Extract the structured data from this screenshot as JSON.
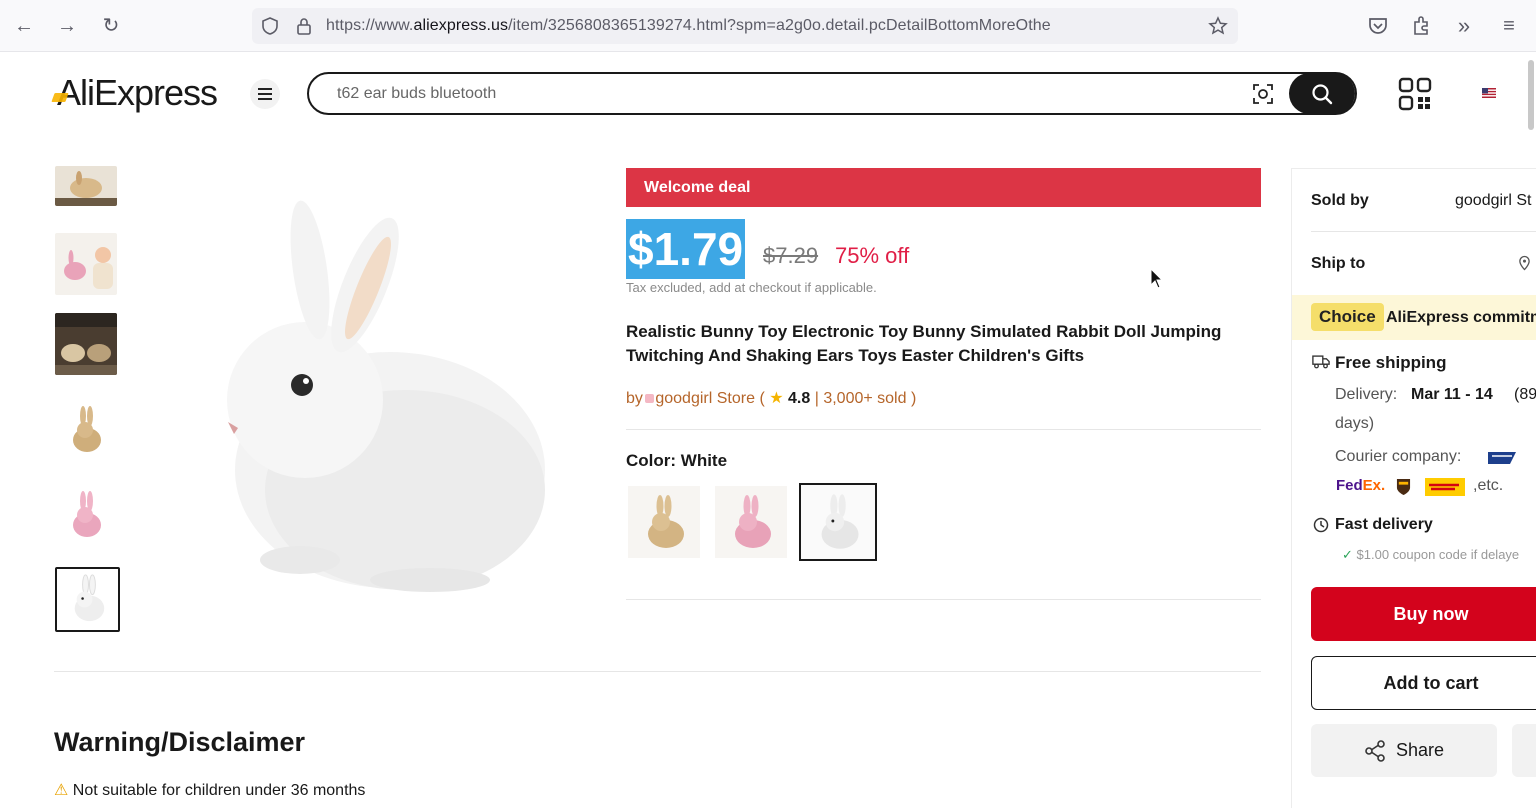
{
  "browser": {
    "url_prefix": "https://www.",
    "url_host": "aliexpress.us",
    "url_path": "/item/3256808365139274.html?spm=a2g0o.detail.pcDetailBottomMoreOthe"
  },
  "header": {
    "logo": "AliExpress",
    "search_placeholder": "t62 ear buds bluetooth"
  },
  "product": {
    "deal_banner": "Welcome deal",
    "price": "$1.79",
    "old_price": "$7.29",
    "discount": "75% off",
    "tax_note": "Tax excluded, add at checkout if applicable.",
    "title": "Realistic Bunny Toy Electronic Toy Bunny Simulated Rabbit Doll Jumping Twitching And Shaking Ears Toys Easter Children's Gifts",
    "store_prefix": "by",
    "store_name": "goodgirl Store",
    "rating": "4.8",
    "sold": "3,000+ sold",
    "color_label": "Color: White"
  },
  "panel": {
    "sold_by_label": "Sold by",
    "sold_by_value": "goodgirl St",
    "ship_to_label": "Ship to",
    "choice_tag": "Choice",
    "choice_text": "AliExpress commitm",
    "free_shipping": "Free shipping",
    "delivery_label": "Delivery:",
    "delivery_date": "Mar 11 - 14",
    "delivery_rest": "(89",
    "delivery_days": "days)",
    "courier_label": "Courier company:",
    "courier_etc": ",etc.",
    "fast_delivery": "Fast delivery",
    "coupon_note": "$1.00 coupon code if delaye",
    "buy_now": "Buy now",
    "add_to_cart": "Add to cart",
    "share": "Share"
  },
  "section": {
    "heading": "Warning/Disclaimer",
    "warning": "Not suitable for children under 36 months"
  },
  "colors": {
    "deal_red": "#dc3545",
    "buy_red": "#d3031c",
    "price_highlight": "#3da7e5",
    "discount_red": "#e01e46",
    "choice_yellow": "#f5de6a"
  }
}
